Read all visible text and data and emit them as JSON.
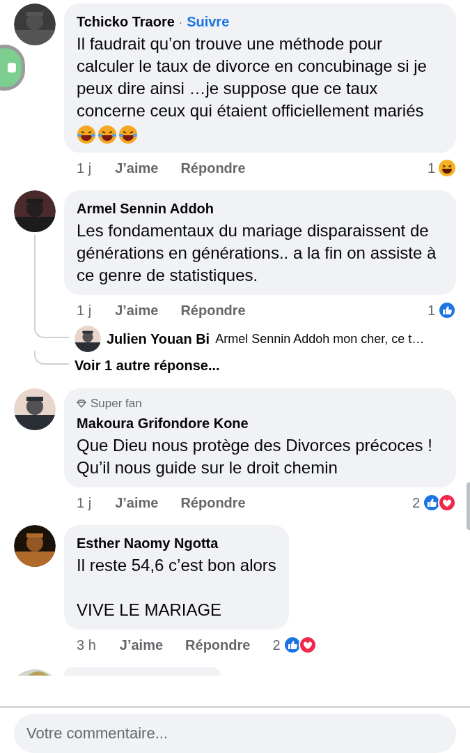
{
  "comments": [
    {
      "author": "Tchicko Traore",
      "separator": "·",
      "follow": "Suivre",
      "text": "Il faudrait qu’on trouve une méthode pour calculer le taux de divorce en concubinage si je peux dire ainsi …je suppose que ce taux concerne ceux qui étaient officiellement mariés",
      "emojis": [
        {
          "kind": "laughing"
        },
        {
          "kind": "laughing"
        },
        {
          "kind": "laughing"
        }
      ],
      "time": "1 j",
      "like": "J’aime",
      "reply": "Répondre",
      "reaction_count": "1",
      "reactions": [
        {
          "kind": "haha"
        }
      ]
    },
    {
      "author": "Armel Sennin Addoh",
      "text": "Les fondamentaux du mariage disparaissent de générations en générations.. a la fin on assiste à ce genre de statistiques.",
      "time": "1 j",
      "like": "J’aime",
      "reply": "Répondre",
      "reaction_count": "1",
      "reactions": [
        {
          "kind": "like"
        }
      ],
      "replies": [
        {
          "author": "Julien Youan Bi",
          "preview": "Armel Sennin Addoh mon cher, ce t…"
        }
      ],
      "more_replies": "Voir 1 autre réponse..."
    },
    {
      "badge": "Super fan",
      "author": "Makoura Grifondore Kone",
      "text": "Que Dieu nous protège des Divorces précoces ! Qu’il nous guide sur le droit chemin",
      "time": "1 j",
      "like": "J’aime",
      "reply": "Répondre",
      "reaction_count": "2",
      "reactions": [
        {
          "kind": "like"
        },
        {
          "kind": "love"
        }
      ]
    },
    {
      "author": "Esther Naomy Ngotta",
      "text": "Il reste 54,6 c’est bon alors\n\nVIVE LE MARIAGE",
      "time": "3 h",
      "like": "J’aime",
      "reply": "Répondre",
      "reaction_count": "2",
      "reactions": [
        {
          "kind": "like"
        },
        {
          "kind": "love"
        }
      ]
    }
  ],
  "composer": {
    "placeholder": "Votre commentaire..."
  }
}
